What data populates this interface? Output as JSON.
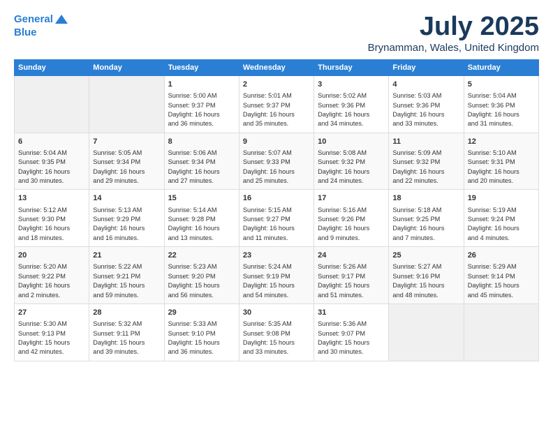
{
  "logo": {
    "line1": "General",
    "line2": "Blue"
  },
  "title": "July 2025",
  "subtitle": "Brynamman, Wales, United Kingdom",
  "header": {
    "days": [
      "Sunday",
      "Monday",
      "Tuesday",
      "Wednesday",
      "Thursday",
      "Friday",
      "Saturday"
    ]
  },
  "weeks": [
    {
      "cells": [
        {
          "day": "",
          "info": ""
        },
        {
          "day": "",
          "info": ""
        },
        {
          "day": "1",
          "info": "Sunrise: 5:00 AM\nSunset: 9:37 PM\nDaylight: 16 hours\nand 36 minutes."
        },
        {
          "day": "2",
          "info": "Sunrise: 5:01 AM\nSunset: 9:37 PM\nDaylight: 16 hours\nand 35 minutes."
        },
        {
          "day": "3",
          "info": "Sunrise: 5:02 AM\nSunset: 9:36 PM\nDaylight: 16 hours\nand 34 minutes."
        },
        {
          "day": "4",
          "info": "Sunrise: 5:03 AM\nSunset: 9:36 PM\nDaylight: 16 hours\nand 33 minutes."
        },
        {
          "day": "5",
          "info": "Sunrise: 5:04 AM\nSunset: 9:36 PM\nDaylight: 16 hours\nand 31 minutes."
        }
      ]
    },
    {
      "cells": [
        {
          "day": "6",
          "info": "Sunrise: 5:04 AM\nSunset: 9:35 PM\nDaylight: 16 hours\nand 30 minutes."
        },
        {
          "day": "7",
          "info": "Sunrise: 5:05 AM\nSunset: 9:34 PM\nDaylight: 16 hours\nand 29 minutes."
        },
        {
          "day": "8",
          "info": "Sunrise: 5:06 AM\nSunset: 9:34 PM\nDaylight: 16 hours\nand 27 minutes."
        },
        {
          "day": "9",
          "info": "Sunrise: 5:07 AM\nSunset: 9:33 PM\nDaylight: 16 hours\nand 25 minutes."
        },
        {
          "day": "10",
          "info": "Sunrise: 5:08 AM\nSunset: 9:32 PM\nDaylight: 16 hours\nand 24 minutes."
        },
        {
          "day": "11",
          "info": "Sunrise: 5:09 AM\nSunset: 9:32 PM\nDaylight: 16 hours\nand 22 minutes."
        },
        {
          "day": "12",
          "info": "Sunrise: 5:10 AM\nSunset: 9:31 PM\nDaylight: 16 hours\nand 20 minutes."
        }
      ]
    },
    {
      "cells": [
        {
          "day": "13",
          "info": "Sunrise: 5:12 AM\nSunset: 9:30 PM\nDaylight: 16 hours\nand 18 minutes."
        },
        {
          "day": "14",
          "info": "Sunrise: 5:13 AM\nSunset: 9:29 PM\nDaylight: 16 hours\nand 16 minutes."
        },
        {
          "day": "15",
          "info": "Sunrise: 5:14 AM\nSunset: 9:28 PM\nDaylight: 16 hours\nand 13 minutes."
        },
        {
          "day": "16",
          "info": "Sunrise: 5:15 AM\nSunset: 9:27 PM\nDaylight: 16 hours\nand 11 minutes."
        },
        {
          "day": "17",
          "info": "Sunrise: 5:16 AM\nSunset: 9:26 PM\nDaylight: 16 hours\nand 9 minutes."
        },
        {
          "day": "18",
          "info": "Sunrise: 5:18 AM\nSunset: 9:25 PM\nDaylight: 16 hours\nand 7 minutes."
        },
        {
          "day": "19",
          "info": "Sunrise: 5:19 AM\nSunset: 9:24 PM\nDaylight: 16 hours\nand 4 minutes."
        }
      ]
    },
    {
      "cells": [
        {
          "day": "20",
          "info": "Sunrise: 5:20 AM\nSunset: 9:22 PM\nDaylight: 16 hours\nand 2 minutes."
        },
        {
          "day": "21",
          "info": "Sunrise: 5:22 AM\nSunset: 9:21 PM\nDaylight: 15 hours\nand 59 minutes."
        },
        {
          "day": "22",
          "info": "Sunrise: 5:23 AM\nSunset: 9:20 PM\nDaylight: 15 hours\nand 56 minutes."
        },
        {
          "day": "23",
          "info": "Sunrise: 5:24 AM\nSunset: 9:19 PM\nDaylight: 15 hours\nand 54 minutes."
        },
        {
          "day": "24",
          "info": "Sunrise: 5:26 AM\nSunset: 9:17 PM\nDaylight: 15 hours\nand 51 minutes."
        },
        {
          "day": "25",
          "info": "Sunrise: 5:27 AM\nSunset: 9:16 PM\nDaylight: 15 hours\nand 48 minutes."
        },
        {
          "day": "26",
          "info": "Sunrise: 5:29 AM\nSunset: 9:14 PM\nDaylight: 15 hours\nand 45 minutes."
        }
      ]
    },
    {
      "cells": [
        {
          "day": "27",
          "info": "Sunrise: 5:30 AM\nSunset: 9:13 PM\nDaylight: 15 hours\nand 42 minutes."
        },
        {
          "day": "28",
          "info": "Sunrise: 5:32 AM\nSunset: 9:11 PM\nDaylight: 15 hours\nand 39 minutes."
        },
        {
          "day": "29",
          "info": "Sunrise: 5:33 AM\nSunset: 9:10 PM\nDaylight: 15 hours\nand 36 minutes."
        },
        {
          "day": "30",
          "info": "Sunrise: 5:35 AM\nSunset: 9:08 PM\nDaylight: 15 hours\nand 33 minutes."
        },
        {
          "day": "31",
          "info": "Sunrise: 5:36 AM\nSunset: 9:07 PM\nDaylight: 15 hours\nand 30 minutes."
        },
        {
          "day": "",
          "info": ""
        },
        {
          "day": "",
          "info": ""
        }
      ]
    }
  ]
}
